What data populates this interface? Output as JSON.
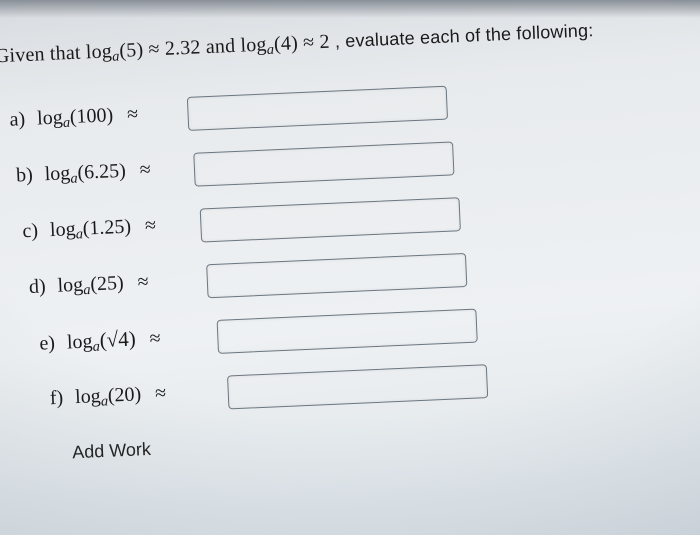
{
  "prompt": {
    "prefix": "Given that ",
    "log1_fn": "log",
    "log1_base": "a",
    "log1_arg": "(5)",
    "approx1": " ≈ ",
    "val1": "2.32",
    "mid": "  and ",
    "log2_fn": "log",
    "log2_base": "a",
    "log2_arg": "(4)",
    "approx2": " ≈ ",
    "val2": "2",
    "tail": " , evaluate each of the following:"
  },
  "questions": [
    {
      "letter": "a)",
      "fn": "log",
      "base": "a",
      "arg": "(100)",
      "approx": "≈"
    },
    {
      "letter": "b)",
      "fn": "log",
      "base": "a",
      "arg": "(6.25)",
      "approx": "≈"
    },
    {
      "letter": "c)",
      "fn": "log",
      "base": "a",
      "arg": "(1.25)",
      "approx": "≈"
    },
    {
      "letter": "d)",
      "fn": "log",
      "base": "a",
      "arg": "(25)",
      "approx": "≈"
    },
    {
      "letter": "e)",
      "fn": "log",
      "base": "a",
      "arg_sqrt": "(√4)",
      "approx": "≈"
    },
    {
      "letter": "f)",
      "fn": "log",
      "base": "a",
      "arg": "(20)",
      "approx": "≈"
    }
  ],
  "add_work_label": "Add Work"
}
